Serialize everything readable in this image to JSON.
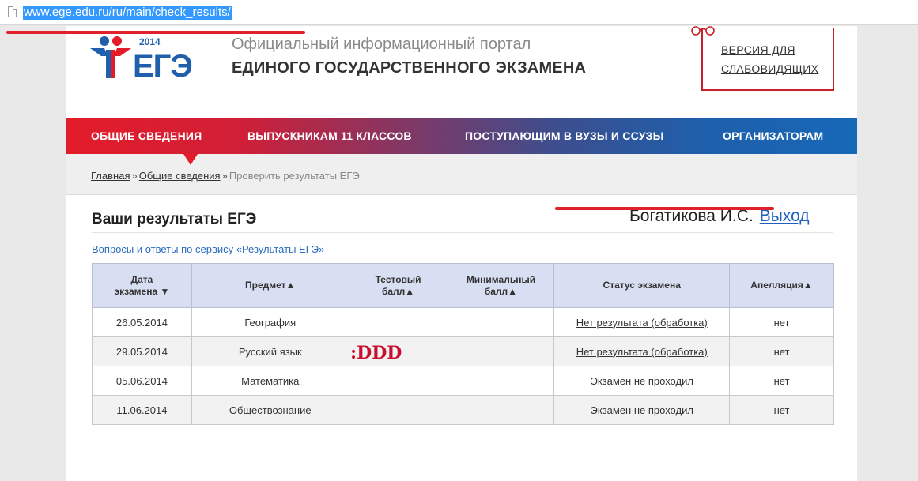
{
  "browser": {
    "url": "www.ege.edu.ru/ru/main/check_results/"
  },
  "header": {
    "logo_year": "2014",
    "logo_text": "ЕГЭ",
    "portal_line1": "Официальный информационный портал",
    "portal_line2": "ЕДИНОГО ГОСУДАРСТВЕННОГО ЭКЗАМЕНА",
    "vision_line1": "ВЕРСИЯ ДЛЯ",
    "vision_line2": "СЛАБОВИДЯЩИХ"
  },
  "nav": {
    "items": [
      {
        "label": "ОБЩИЕ СВЕДЕНИЯ"
      },
      {
        "label": "ВЫПУСКНИКАМ 11 КЛАССОВ"
      },
      {
        "label": "ПОСТУПАЮЩИМ В ВУЗЫ И ССУЗЫ"
      },
      {
        "label": "ОРГАНИЗАТОРАМ"
      }
    ],
    "active_index": 0
  },
  "breadcrumb": {
    "home": "Главная",
    "section": "Общие сведения",
    "current": "Проверить результаты ЕГЭ",
    "separator": "»"
  },
  "results": {
    "title": "Ваши результаты ЕГЭ",
    "user_name": "Богатикова И.С.",
    "logout": "Выход",
    "faq_link": "Вопросы и ответы по сервису «Результаты ЕГЭ»",
    "columns": {
      "date_line1": "Дата",
      "date_line2": "экзамена ▼",
      "subject": "Предмет▲",
      "test_line1": "Тестовый",
      "test_line2": "балл▲",
      "min_line1": "Минимальный",
      "min_line2": "балл▲",
      "status": "Статус экзамена",
      "appeal": "Апелляция▲"
    },
    "rows": [
      {
        "date": "26.05.2014",
        "subject": "География",
        "test": "",
        "min": "",
        "status": "Нет результата (обработка)",
        "appeal": "нет"
      },
      {
        "date": "29.05.2014",
        "subject": "Русский язык",
        "test": "",
        "min": "",
        "status": "Нет результата (обработка)",
        "appeal": "нет"
      },
      {
        "date": "05.06.2014",
        "subject": "Математика",
        "test": "",
        "min": "",
        "status": "Экзамен не проходил",
        "appeal": "нет"
      },
      {
        "date": "11.06.2014",
        "subject": "Обществознание",
        "test": "",
        "min": "",
        "status": "Экзамен не проходил",
        "appeal": "нет"
      }
    ]
  },
  "annotation": {
    "text": ":DDD",
    "color": "#c8102e"
  },
  "colors": {
    "brand_red": "#e41c2a",
    "brand_blue": "#1668b8",
    "table_header": "#d9dff3"
  }
}
